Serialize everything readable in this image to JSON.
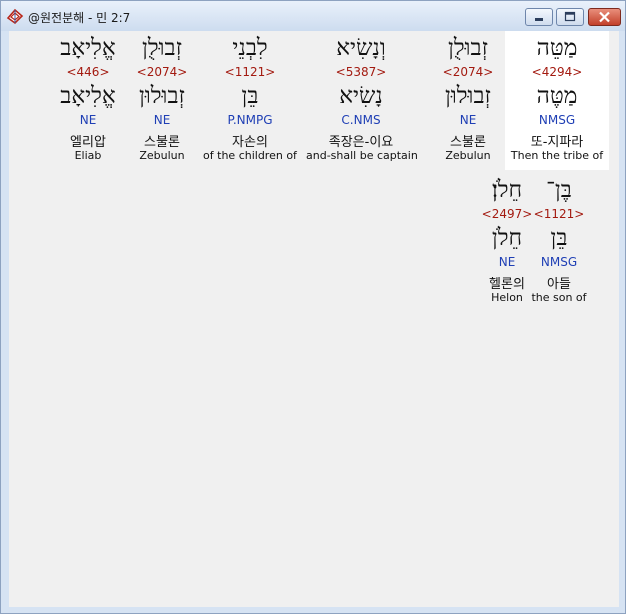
{
  "window": {
    "title": "@원전분해 - 민 2:7",
    "app_icon": "bible-book-icon",
    "controls": {
      "minimize_icon": "minimize-icon",
      "maximize_icon": "maximize-icon",
      "close_icon": "close-icon"
    }
  },
  "colors": {
    "strong": "#a31a10",
    "parsing": "#1f3fb5",
    "highlight": "#ffffff"
  },
  "verse": {
    "reference": "민 2:7",
    "words": [
      {
        "hebrew": "מַטֵּה",
        "strong": "<4294>",
        "lemma": "מַטֶּה",
        "parsing": "NMSG",
        "korean": "또-지파라",
        "english": "Then the tribe of",
        "selected": true
      },
      {
        "hebrew": "זְבוּלֻן",
        "strong": "<2074>",
        "lemma": "זְבוּלוּן",
        "parsing": "NE",
        "korean": "스불론",
        "english": "Zebulun"
      },
      {
        "hebrew": "וְנָשִׂיא",
        "strong": "<5387>",
        "lemma": "נָשִׂיא",
        "parsing": "C.NMS",
        "korean": "족장은-이요",
        "english": "and-shall be captain"
      },
      {
        "hebrew": "לִבְנֵי",
        "strong": "<1121>",
        "lemma": "בֵּן",
        "parsing": "P.NMPG",
        "korean": "자손의",
        "english": "of the children of"
      },
      {
        "hebrew": "זְבוּלֻן",
        "strong": "<2074>",
        "lemma": "זְבוּלוּן",
        "parsing": "NE",
        "korean": "스불론",
        "english": "Zebulun"
      },
      {
        "hebrew": "אֱלִיאָב",
        "strong": "<446>",
        "lemma": "אֱלִיאָב",
        "parsing": "NE",
        "korean": "엘리압",
        "english": "Eliab"
      },
      {
        "hebrew": "בֶּן־",
        "strong": "<1121>",
        "lemma": "בֵּן",
        "parsing": "NMSG",
        "korean": "아들",
        "english": "the son of"
      },
      {
        "hebrew": "חֵלֹן׃",
        "strong": "<2497>",
        "lemma": "חֵלֹן",
        "parsing": "NE",
        "korean": "헬론의",
        "english": "Helon"
      }
    ]
  }
}
